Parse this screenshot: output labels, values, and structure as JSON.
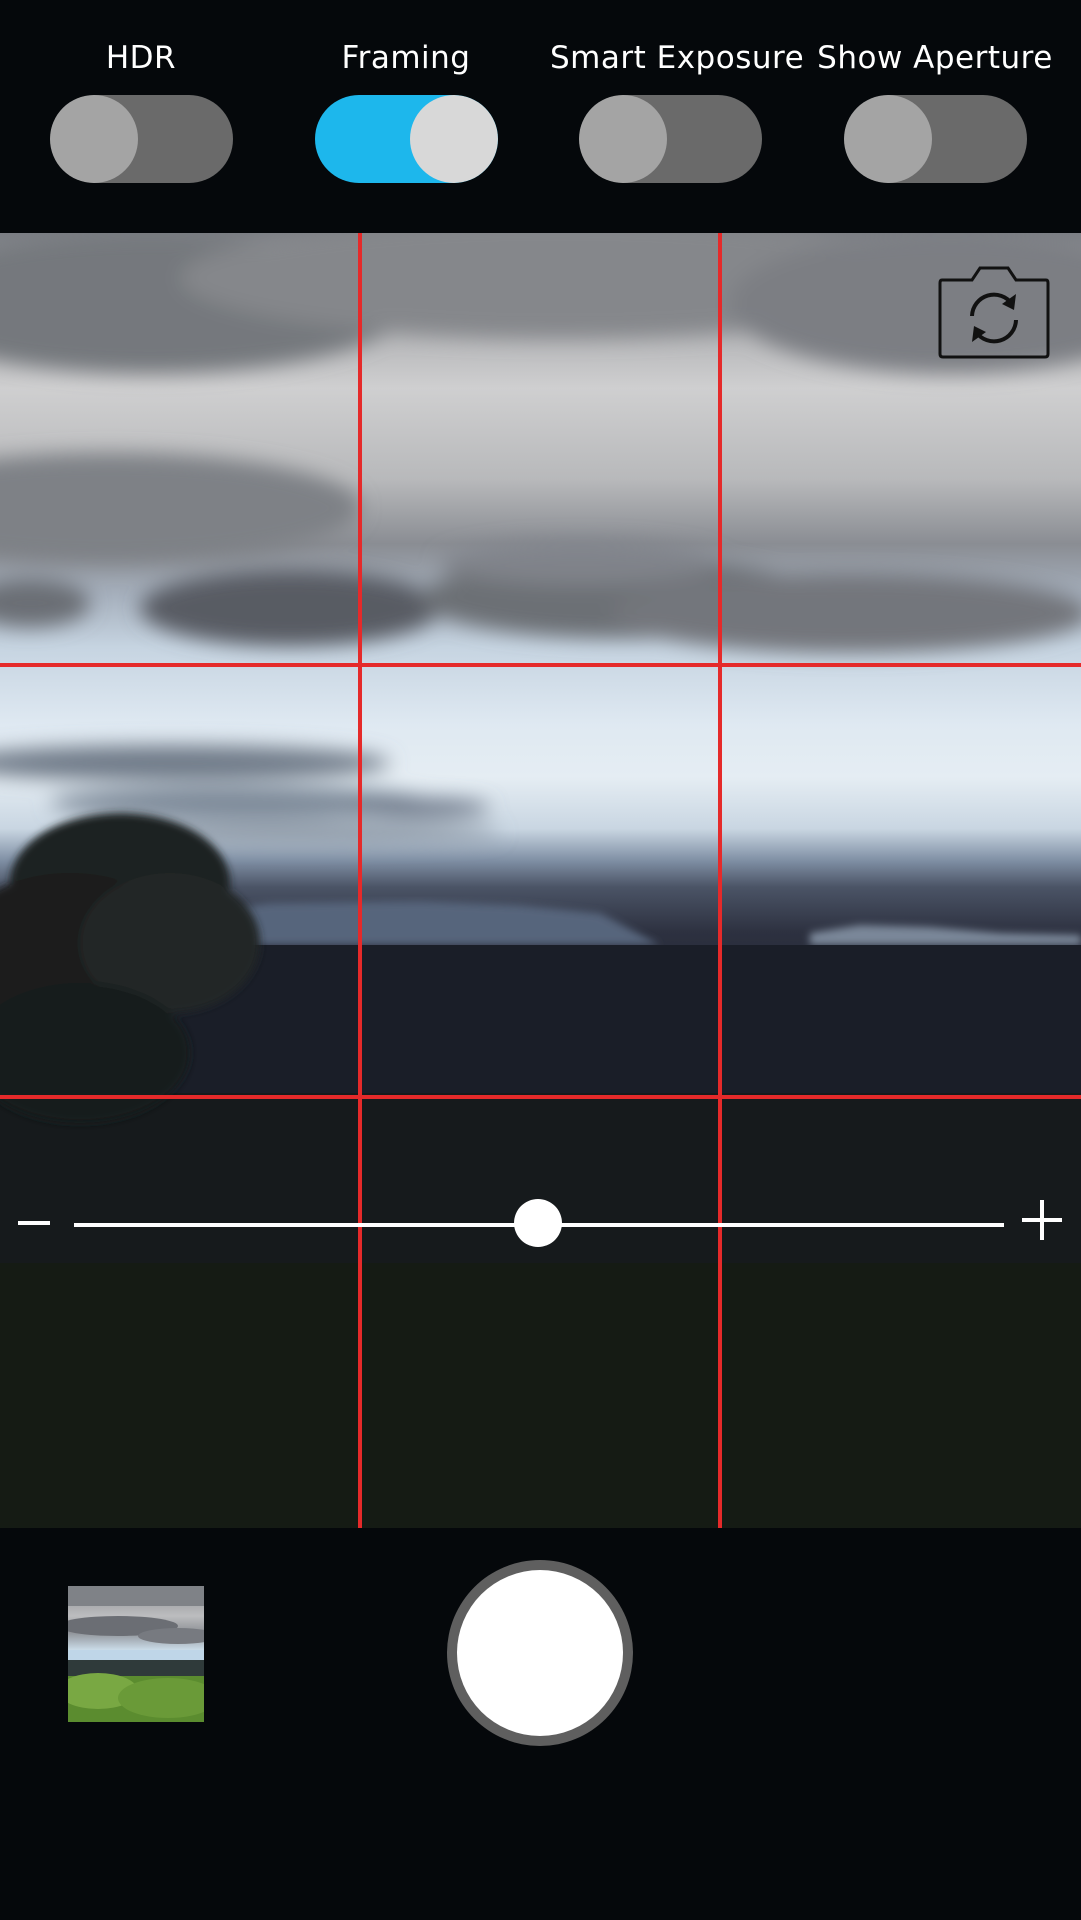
{
  "toggles": [
    {
      "label": "HDR",
      "on": false
    },
    {
      "label": "Framing",
      "on": true
    },
    {
      "label": "Smart Exposure",
      "on": false
    },
    {
      "label": "Show Aperture",
      "on": false
    }
  ],
  "colors": {
    "toggle_on": "#1db7ec",
    "toggle_off": "#6a6a6a",
    "grid_lines": "#e52a2a",
    "background": "#05080b"
  },
  "viewfinder": {
    "grid": "rule-of-thirds",
    "flip_camera_icon": "camera-switch-icon"
  },
  "zoom": {
    "minus_icon": "minus-icon",
    "plus_icon": "plus-icon",
    "level": 0.5
  },
  "capture": {
    "shutter_icon": "shutter-button",
    "last_photo_icon": "photo-thumbnail"
  }
}
